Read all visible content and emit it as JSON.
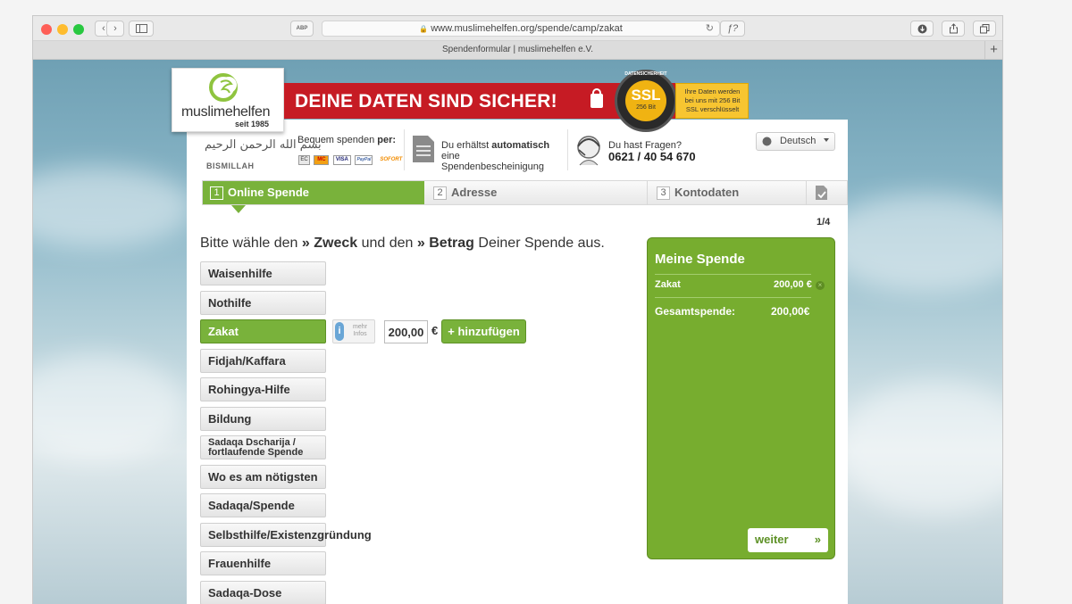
{
  "browser": {
    "url": "www.muslimehelfen.org/spende/camp/zakat",
    "tab_title": "Spendenformular | muslimehelfen e.V.",
    "reader_label": "ABP",
    "formula_label": "ƒ?",
    "new_tab": "+"
  },
  "logo": {
    "name": "muslimehelfen",
    "since": "seit 1985"
  },
  "banner": {
    "headline": "DEINE DATEN SIND SICHER!",
    "ssl": "SSL",
    "bits": "256 Bit",
    "seal_ring": "DATENSICHERHEIT",
    "note": "Ihre Daten werden bei uns mit 256 Bit SSL verschlüsselt"
  },
  "header": {
    "bismillah": "BISMILLAH",
    "payment_label_1": "Bequem spenden",
    "payment_label_2": "per:",
    "payment_methods": [
      "EC",
      "MC",
      "VISA",
      "PayPal",
      "SOFORT"
    ],
    "receipt_1": "Du erhältst",
    "receipt_2": "automatisch",
    "receipt_3": "eine",
    "receipt_4": "Spendenbescheinigung",
    "questions": "Du hast Fragen?",
    "phone": "0621 / 40 54 670",
    "language": "Deutsch"
  },
  "steps": [
    {
      "num": "1",
      "label": "Online Spende"
    },
    {
      "num": "2",
      "label": "Adresse"
    },
    {
      "num": "3",
      "label": "Kontodaten"
    }
  ],
  "counter": "1/4",
  "headline": {
    "part1": "Bitte wähle den",
    "arrow": "»",
    "bold1": "Zweck",
    "mid": "und den",
    "bold2": "Betrag",
    "part2": "Deiner Spende aus."
  },
  "purposes": [
    "Waisenhilfe",
    "Nothilfe",
    "Zakat",
    "Fidjah/Kaffara",
    "Rohingya-Hilfe",
    "Bildung",
    "Sadaqa Dscharija / fortlaufende Spende",
    "Wo es am nötigsten",
    "Sadaqa/Spende",
    "Selbsthilfe/Existenzgründung",
    "Frauenhilfe",
    "Sadaqa-Dose"
  ],
  "info": {
    "letter": "i",
    "text": "mehr Infos"
  },
  "amount": {
    "value": "200,00",
    "currency": "€",
    "add": "+ hinzufügen"
  },
  "sidebar": {
    "title": "Meine Spende",
    "item_name": "Zakat",
    "item_value": "200,00 €",
    "total_label": "Gesamtspende:",
    "total_value": "200,00€",
    "next": "weiter",
    "next_arrow": "»"
  },
  "colors": {
    "green": "#79b23b",
    "red": "#c61b24",
    "gold": "#f0b312"
  }
}
